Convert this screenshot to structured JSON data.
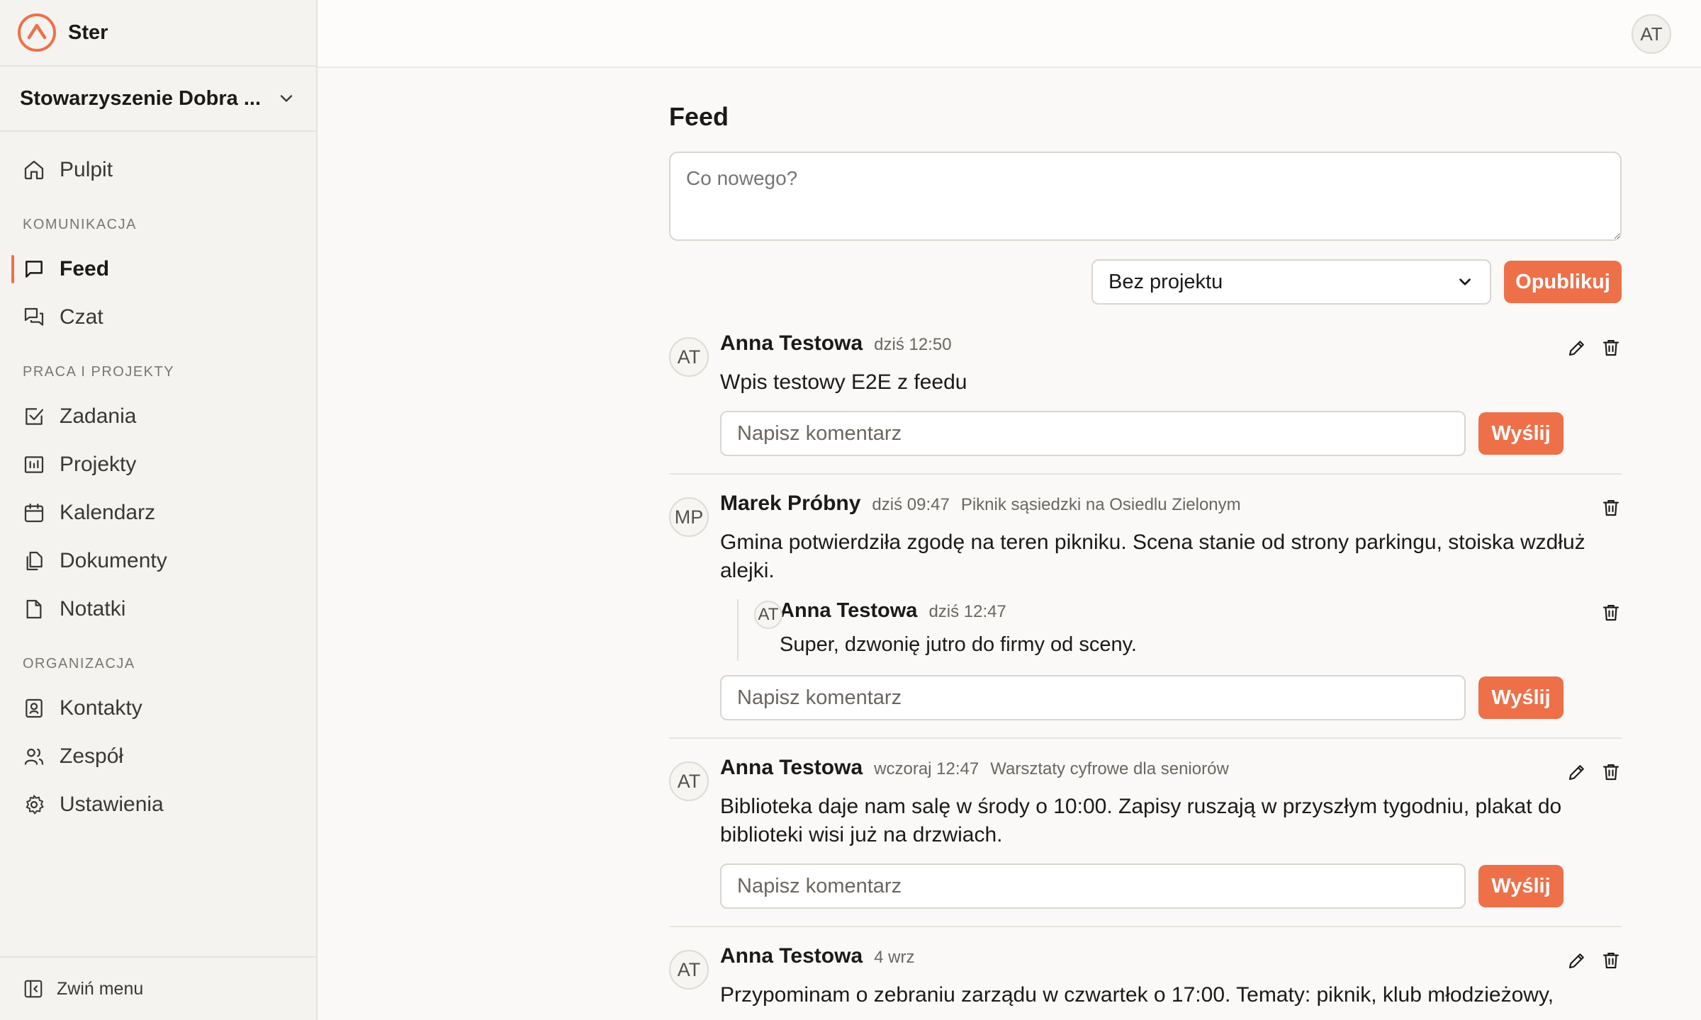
{
  "app": {
    "name": "Ster"
  },
  "org": {
    "name": "Stowarzyszenie Dobra ..."
  },
  "user": {
    "initials": "AT"
  },
  "nav": {
    "home": "Pulpit",
    "sections": [
      {
        "label": "KOMUNIKACJA",
        "items": [
          "Feed",
          "Czat"
        ]
      },
      {
        "label": "PRACA I PROJEKTY",
        "items": [
          "Zadania",
          "Projekty",
          "Kalendarz",
          "Dokumenty",
          "Notatki"
        ]
      },
      {
        "label": "ORGANIZACJA",
        "items": [
          "Kontakty",
          "Zespół",
          "Ustawienia"
        ]
      }
    ],
    "collapse": "Zwiń menu"
  },
  "feed": {
    "title": "Feed",
    "composer_placeholder": "Co nowego?",
    "project_select": "Bez projektu",
    "publish": "Opublikuj",
    "comment_placeholder": "Napisz komentarz",
    "send": "Wyślij",
    "posts": [
      {
        "initials": "AT",
        "author": "Anna Testowa",
        "time": "dziś 12:50",
        "project": "",
        "body": "Wpis testowy E2E z feedu"
      },
      {
        "initials": "MP",
        "author": "Marek Próbny",
        "time": "dziś 09:47",
        "project": "Piknik sąsiedzki na Osiedlu Zielonym",
        "body": "Gmina potwierdziła zgodę na teren pikniku. Scena stanie od strony parkingu, stoiska wzdłuż alejki.",
        "comments": [
          {
            "initials": "AT",
            "author": "Anna Testowa",
            "time": "dziś 12:47",
            "body": "Super, dzwonię jutro do firmy od sceny."
          }
        ]
      },
      {
        "initials": "AT",
        "author": "Anna Testowa",
        "time": "wczoraj 12:47",
        "project": "Warsztaty cyfrowe dla seniorów",
        "body": "Biblioteka daje nam salę w środy o 10:00. Zapisy ruszają w przyszłym tygodniu, plakat do biblioteki wisi już na drzwiach."
      },
      {
        "initials": "AT",
        "author": "Anna Testowa",
        "time": "4 wrz",
        "project": "",
        "body": "Przypominam o zebraniu zarządu w czwartek o 17:00. Tematy: piknik, klub młodzieżowy,"
      }
    ]
  }
}
